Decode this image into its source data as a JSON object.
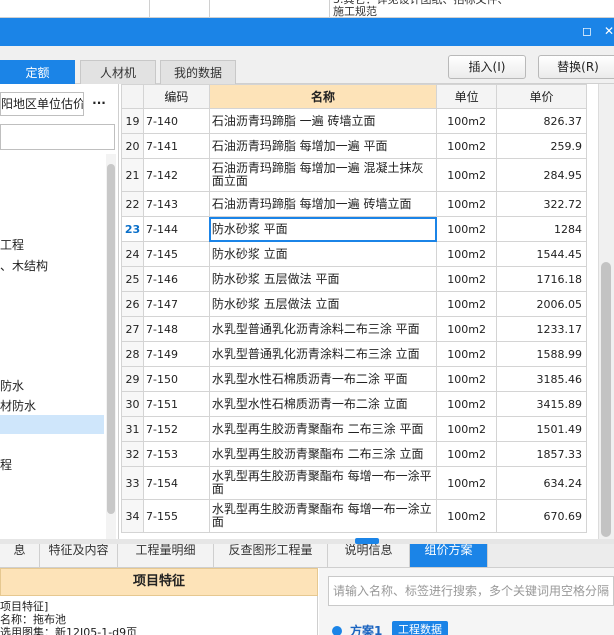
{
  "top_note": "3.其它：详见设计图纸、招标文件、施工规范",
  "tabs": [
    "定额",
    "人材机",
    "我的数据"
  ],
  "buttons": {
    "insert": "插入(I)",
    "replace": "替换(R)"
  },
  "left": {
    "region": "阳地区单位估价表",
    "more": "···",
    "tree": [
      "工程",
      "、木结构",
      "防水",
      "材防水",
      "程"
    ]
  },
  "grid": {
    "headers": {
      "code": "编码",
      "name": "名称",
      "unit": "单位",
      "price": "单价"
    },
    "current_row": "23",
    "rows": [
      {
        "no": "19",
        "code": "7-140",
        "name": "石油沥青玛蹄脂 一遍 砖墙立面",
        "unit": "100m2",
        "price": "826.37"
      },
      {
        "no": "20",
        "code": "7-141",
        "name": "石油沥青玛蹄脂 每增加一遍 平面",
        "unit": "100m2",
        "price": "259.9"
      },
      {
        "no": "21",
        "code": "7-142",
        "name": "石油沥青玛蹄脂 每增加一遍 混凝土抹灰面立面",
        "unit": "100m2",
        "price": "284.95"
      },
      {
        "no": "22",
        "code": "7-143",
        "name": "石油沥青玛蹄脂 每增加一遍 砖墙立面",
        "unit": "100m2",
        "price": "322.72"
      },
      {
        "no": "23",
        "code": "7-144",
        "name": "防水砂浆 平面",
        "unit": "100m2",
        "price": "1284"
      },
      {
        "no": "24",
        "code": "7-145",
        "name": "防水砂浆 立面",
        "unit": "100m2",
        "price": "1544.45"
      },
      {
        "no": "25",
        "code": "7-146",
        "name": "防水砂浆 五层做法 平面",
        "unit": "100m2",
        "price": "1716.18"
      },
      {
        "no": "26",
        "code": "7-147",
        "name": "防水砂浆 五层做法 立面",
        "unit": "100m2",
        "price": "2006.05"
      },
      {
        "no": "27",
        "code": "7-148",
        "name": "水乳型普通乳化沥青涂料二布三涂 平面",
        "unit": "100m2",
        "price": "1233.17"
      },
      {
        "no": "28",
        "code": "7-149",
        "name": "水乳型普通乳化沥青涂料二布三涂 立面",
        "unit": "100m2",
        "price": "1588.99"
      },
      {
        "no": "29",
        "code": "7-150",
        "name": "水乳型水性石棉质沥青一布二涂 平面",
        "unit": "100m2",
        "price": "3185.46"
      },
      {
        "no": "30",
        "code": "7-151",
        "name": "水乳型水性石棉质沥青一布二涂 立面",
        "unit": "100m2",
        "price": "3415.89"
      },
      {
        "no": "31",
        "code": "7-152",
        "name": "水乳型再生胶沥青聚酯布 二布三涂 平面",
        "unit": "100m2",
        "price": "1501.49"
      },
      {
        "no": "32",
        "code": "7-153",
        "name": "水乳型再生胶沥青聚酯布 二布三涂 立面",
        "unit": "100m2",
        "price": "1857.33"
      },
      {
        "no": "33",
        "code": "7-154",
        "name": "水乳型再生胶沥青聚酯布 每增一布一涂平面",
        "unit": "100m2",
        "price": "634.24"
      },
      {
        "no": "34",
        "code": "7-155",
        "name": "水乳型再生胶沥青聚酯布 每增一布一涂立面",
        "unit": "100m2",
        "price": "670.69"
      }
    ]
  },
  "bottom_tabs": [
    "息",
    "特征及内容",
    "工程量明细",
    "反查图形工程量",
    "说明信息",
    "组价方案"
  ],
  "feature": {
    "header": "项目特征",
    "lines": [
      "项目特征]",
      "名称：拖布池",
      "选用图集：新12J05-1-d9页"
    ]
  },
  "right_search": {
    "placeholder": "请输入名称、标签进行搜索，多个关键词用空格分隔",
    "scheme": "方案1",
    "badge": "工程数据"
  },
  "colors": {
    "accent": "#1b84e7",
    "header_highlight": "#fde3b8",
    "selection": "#cfe6fb"
  }
}
